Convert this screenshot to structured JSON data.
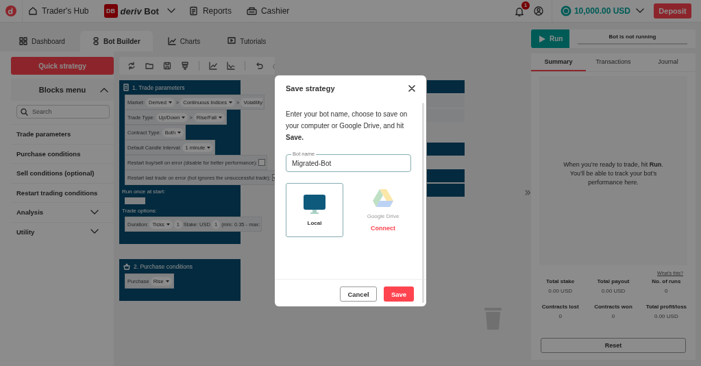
{
  "header": {
    "hub_label": "Trader's Hub",
    "app_badge": "DB",
    "app_name_prefix": "deriv",
    "app_name": "Bot",
    "nav": [
      {
        "label": "Reports"
      },
      {
        "label": "Cashier"
      }
    ],
    "notification_count": "1",
    "balance": "10,000.00 USD",
    "deposit_label": "Deposit"
  },
  "tabs": [
    {
      "label": "Dashboard",
      "selected": false
    },
    {
      "label": "Bot Builder",
      "selected": true
    },
    {
      "label": "Charts",
      "selected": false
    },
    {
      "label": "Tutorials",
      "selected": false
    }
  ],
  "sidebar": {
    "quick_strategy_label": "Quick strategy",
    "blocks_menu": {
      "title": "Blocks menu",
      "expanded": true
    },
    "search": {
      "placeholder": "Search"
    },
    "items": [
      {
        "kind": "category",
        "label": "Trade parameters"
      },
      {
        "kind": "category",
        "label": "Purchase conditions"
      },
      {
        "kind": "category",
        "label": "Sell conditions (optional)"
      },
      {
        "kind": "category",
        "label": "Restart trading conditions"
      },
      {
        "kind": "group",
        "label": "Analysis",
        "expanded": false
      },
      {
        "kind": "group",
        "label": "Utility",
        "expanded": false
      }
    ]
  },
  "workspace": {
    "blocks": [
      {
        "title": "1. Trade parameters",
        "rows": [
          {
            "kind": "field",
            "parts": [
              {
                "kind": "text",
                "text": "Market:"
              },
              {
                "kind": "dropdown",
                "text": "Derived"
              },
              {
                "kind": "text",
                "text": ">"
              },
              {
                "kind": "dropdown",
                "text": "Continuous Indices"
              },
              {
                "kind": "text",
                "text": ">"
              },
              {
                "kind": "cut",
                "text": "Volatility"
              }
            ]
          },
          {
            "kind": "field",
            "parts": [
              {
                "kind": "text",
                "text": "Trade Type:"
              },
              {
                "kind": "dropdown",
                "text": "Up/Down"
              },
              {
                "kind": "text",
                "text": ">"
              },
              {
                "kind": "dropdown",
                "text": "Rise/Fall"
              }
            ]
          },
          {
            "kind": "field",
            "parts": [
              {
                "kind": "text",
                "text": "Contract Type:"
              },
              {
                "kind": "dropdown",
                "text": "Both"
              }
            ]
          },
          {
            "kind": "field",
            "parts": [
              {
                "kind": "text",
                "text": "Default Candle Interval:"
              },
              {
                "kind": "dropdown",
                "text": "1 minute"
              }
            ]
          },
          {
            "kind": "field",
            "parts": [
              {
                "kind": "text",
                "text": "Restart buy/sell on error (disable for better performance):"
              },
              {
                "kind": "checkbox",
                "checked": false
              }
            ]
          },
          {
            "kind": "field",
            "parts": [
              {
                "kind": "text",
                "text": "Restart last trade on error (bot ignores the unsuccessful trade):"
              },
              {
                "kind": "checkbox",
                "checked": true
              }
            ]
          },
          {
            "kind": "section",
            "label": "Run once at start:"
          },
          {
            "kind": "slot"
          },
          {
            "kind": "section",
            "label": "Trade options:"
          },
          {
            "kind": "field",
            "parts": [
              {
                "kind": "text",
                "text": "Duration:"
              },
              {
                "kind": "dropdown",
                "text": "Ticks"
              },
              {
                "kind": "input",
                "text": "1"
              },
              {
                "kind": "text",
                "text": "Stake:"
              },
              {
                "kind": "text",
                "text": "USD"
              },
              {
                "kind": "input",
                "text": "1"
              },
              {
                "kind": "text",
                "text": "(min: 0.35 - max:"
              }
            ]
          }
        ]
      },
      {
        "title": "2. Purchase conditions",
        "rows": [
          {
            "kind": "field",
            "parts": [
              {
                "kind": "text",
                "text": "Purchase"
              },
              {
                "kind": "dropdown",
                "text": "Rise"
              }
            ]
          }
        ]
      }
    ]
  },
  "run_panel": {
    "run_label": "Run",
    "status": "Bot is not running",
    "tabs": [
      {
        "label": "Summary",
        "selected": true
      },
      {
        "label": "Transactions",
        "selected": false
      },
      {
        "label": "Journal",
        "selected": false
      }
    ],
    "empty_message": "When you’re ready to trade, hit **Run**. You’ll be able to track your bot’s performance here.",
    "whats_this": "What's this?",
    "stats": [
      {
        "label": "Total stake",
        "value": "0.00 USD"
      },
      {
        "label": "Total payout",
        "value": "0.00 USD"
      },
      {
        "label": "No. of runs",
        "value": "0"
      },
      {
        "label": "Contracts lost",
        "value": "0"
      },
      {
        "label": "Contracts won",
        "value": "0"
      },
      {
        "label": "Total profit/loss",
        "value": "0.00 USD"
      }
    ],
    "reset_label": "Reset"
  },
  "modal": {
    "title": "Save strategy",
    "intro": "Enter your bot name, choose to save on your computer or Google Drive, and hit **Save.**",
    "bot_name": {
      "label": "Bot name",
      "value": "Migrated-Bot"
    },
    "options": [
      {
        "kind": "local",
        "label": "Local",
        "selected": true
      },
      {
        "kind": "drive",
        "label": "Google Drive",
        "action": "Connect",
        "selected": false
      }
    ],
    "buttons": [
      {
        "kind": "secondary",
        "label": "Cancel"
      },
      {
        "kind": "primary",
        "label": "Save"
      }
    ]
  }
}
